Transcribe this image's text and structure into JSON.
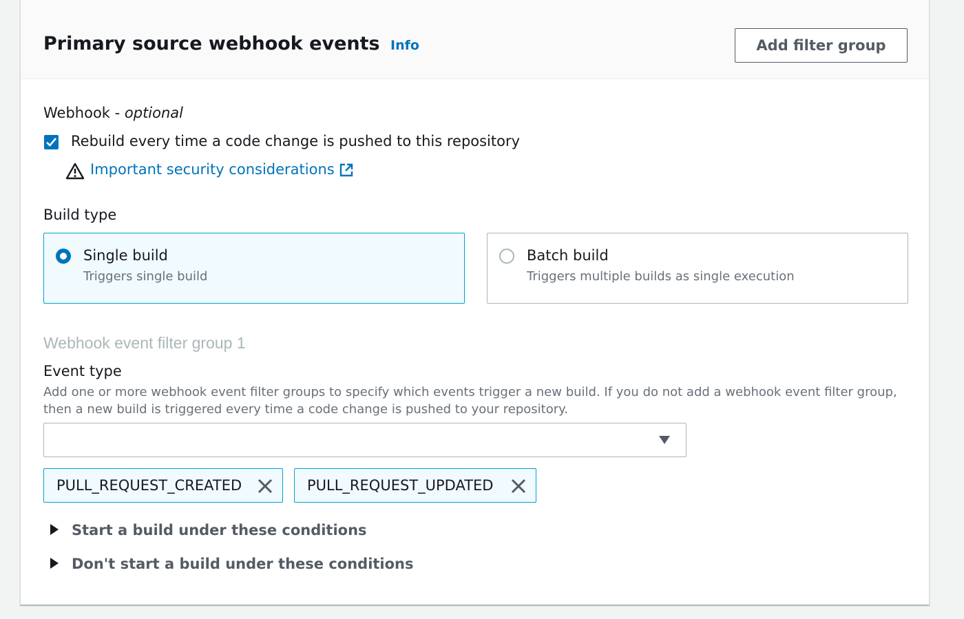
{
  "header": {
    "title": "Primary source webhook events",
    "info_label": "Info",
    "add_filter_group_label": "Add filter group"
  },
  "webhook": {
    "label": "Webhook",
    "separator": " - ",
    "optional_label": "optional",
    "checkbox_label": "Rebuild every time a code change is pushed to this repository",
    "checkbox_checked": true,
    "security_link_label": "Important security considerations"
  },
  "build_type": {
    "label": "Build type",
    "options": [
      {
        "title": "Single build",
        "description": "Triggers single build",
        "selected": true
      },
      {
        "title": "Batch build",
        "description": "Triggers multiple builds as single execution",
        "selected": false
      }
    ]
  },
  "filter_group": {
    "heading": "Webhook event filter group 1",
    "event_type_label": "Event type",
    "event_type_description": "Add one or more webhook event filter groups to specify which events trigger a new build. If you do not add a webhook event filter group, then a new build is triggered every time a code change is pushed to your repository.",
    "select_value": "",
    "tokens": [
      "PULL_REQUEST_CREATED",
      "PULL_REQUEST_UPDATED"
    ],
    "expanders": [
      "Start a build under these conditions",
      "Don't start a build under these conditions"
    ]
  },
  "colors": {
    "accent": "#0073bb",
    "selected_bg": "#f1faff",
    "selected_border": "#00a1c9",
    "secondary_text": "#687078",
    "disabled_heading": "#aab7b8"
  },
  "icons": {
    "warning": "warning-icon",
    "external": "external-link-icon",
    "dropdown": "caret-down-icon",
    "dismiss": "close-icon",
    "expand": "caret-right-icon",
    "check": "check-icon"
  }
}
